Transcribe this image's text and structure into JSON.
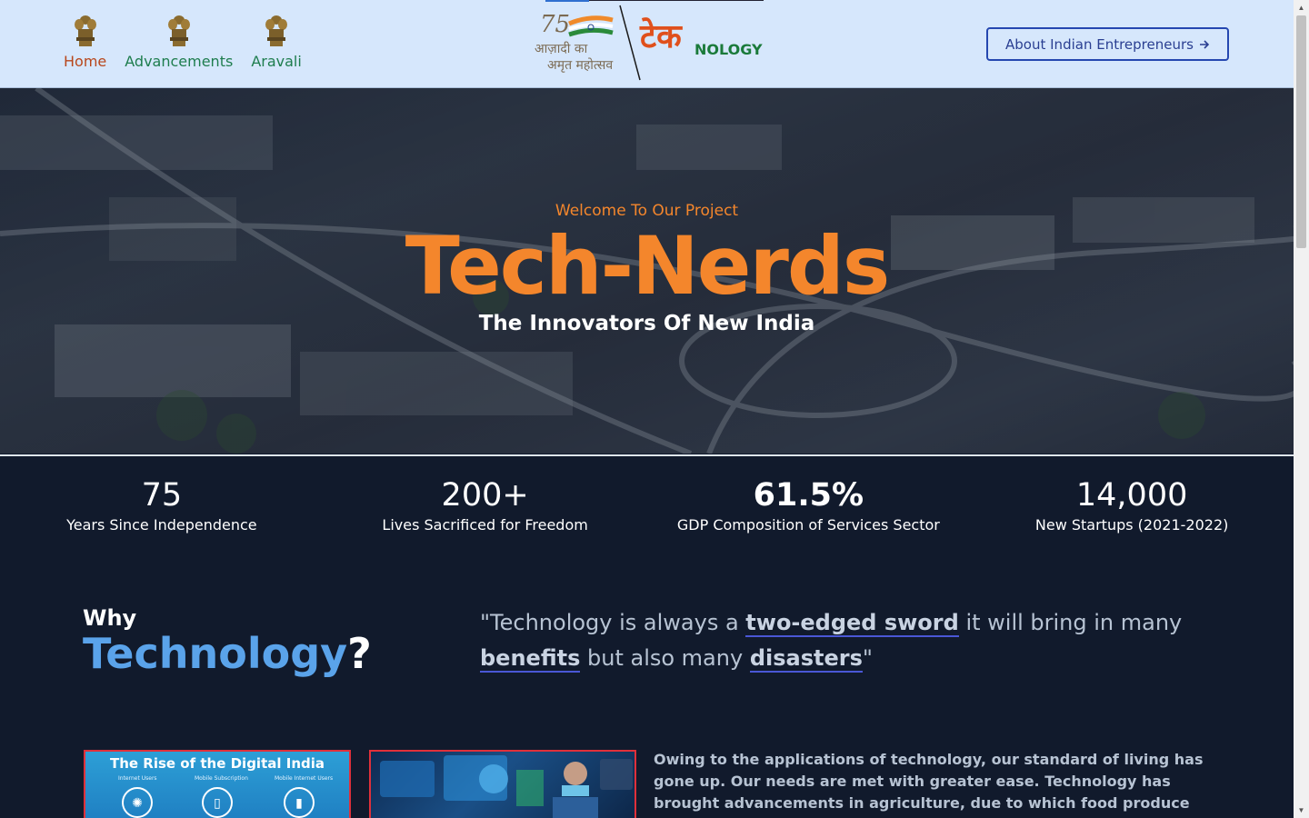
{
  "header": {
    "nav": [
      {
        "label": "Home",
        "icon": "national-emblem-icon",
        "active": true
      },
      {
        "label": "Advancements",
        "icon": "national-emblem-icon",
        "active": false
      },
      {
        "label": "Aravali",
        "icon": "national-emblem-icon",
        "active": false
      }
    ],
    "logo": {
      "number": "75",
      "hindi_line1": "आज़ादी का",
      "hindi_line2": "अमृत महोत्सव",
      "tek": "टेक",
      "nology": "NOLOGY"
    },
    "about_button": {
      "label": "About Indian Entrepreneurs",
      "icon": "arrow-right-icon"
    }
  },
  "hero": {
    "welcome": "Welcome To Our Project",
    "title": "Tech-Nerds",
    "subtitle": "The Innovators Of New India"
  },
  "stats": [
    {
      "value": "75",
      "label": "Years Since Independence"
    },
    {
      "value": "200+",
      "label": "Lives Sacrificed for Freedom"
    },
    {
      "value": "61.5%",
      "label": "GDP Composition of Services Sector"
    },
    {
      "value": "14,000",
      "label": "New Startups (2021-2022)"
    }
  ],
  "why": {
    "small": "Why",
    "big": "Technology",
    "big_mark": "?",
    "quote_open": "\"Technology is always a ",
    "quote_hl1": "two-edged sword",
    "quote_mid1": " it will bring in many ",
    "quote_hl2": "benefits",
    "quote_mid2": " but also many ",
    "quote_hl3": "disasters",
    "quote_close": "\"",
    "card1": {
      "title": "The Rise of the Digital India",
      "labels": [
        "Internet Users",
        "Mobile Subscription",
        "Mobile Internet Users"
      ]
    },
    "body": "Owing to the applications of technology, our standard of living has gone up. Our needs are met with greater ease. Technology has brought advancements in agriculture, due to which food produce has increased."
  },
  "colors": {
    "header_bg": "#d6e7fc",
    "accent_orange": "#f4862c",
    "dark_bg": "#111a2c",
    "nav_green": "#1e7d4e",
    "nav_active": "#b8471c",
    "button_blue": "#2547b0",
    "highlight_blue": "#5aa3ea"
  }
}
